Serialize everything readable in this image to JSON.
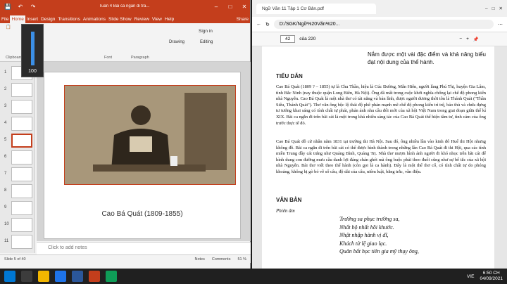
{
  "ppt": {
    "title": "Tuan 4 Bai ca ngan di tra...",
    "tabs": [
      "File",
      "Home",
      "Insert",
      "Design",
      "Transitions",
      "Animations",
      "Slide Show",
      "Review",
      "View",
      "Help",
      "Share"
    ],
    "active_tab": "Home",
    "sign_in": "Sign in",
    "ribbon_groups": [
      "Clipboard",
      "Font",
      "Paragraph"
    ],
    "ribbon_buttons": [
      "Drawing",
      "Editing"
    ],
    "slide_caption": "Cao Bá Quát (1809-1855)",
    "notes_placeholder": "Click to add notes",
    "status_slide": "Slide 5 of 40",
    "status_notes": "Notes",
    "status_comments": "Comments",
    "zoom": "51 %",
    "thumb_numbers": [
      "1",
      "2",
      "3",
      "4",
      "5",
      "6",
      "7",
      "8",
      "9",
      "10",
      "11"
    ],
    "selected_thumb": "5"
  },
  "volume": {
    "value": "100",
    "level": 1.0
  },
  "pdf": {
    "tab_title": "Ngữ Văn 11 Tập 1 Cơ Bản.pdf",
    "url": "D:/SGK/Ngữ%20Văn%20...",
    "page_current": "42",
    "page_total": "của 220",
    "top_text": "Nắm được một vài đặc điểm và khả năng biểu đạt nội dung của thể hành.",
    "heading_intro": "TIỂU DẪN",
    "para1": "Cao Bá Quát (1809 ? – 1855) tự là Chu Thần, hiệu là Cúc Đường, Mẫn Hiên, người làng Phú Thị, huyện Gia Lâm, tỉnh Bắc Ninh (nay thuộc quận Long Biên, Hà Nội). Ông đã mất trong cuộc khởi nghĩa chống lại chế độ phong kiến nhà Nguyễn. Cao Bá Quát là một nhà thơ có tài năng và bản lĩnh, được người đương thời tôn là Thánh Quát (\"Thần Siêu, Thánh Quát\"). Thơ văn ông bộc lộ thái độ phê phán mạnh mẽ chế độ phong kiến trì trệ, bảo thủ và chứa đựng tư tưởng khai sáng có tính chất tự phát, phản ánh nhu cầu đổi mới của xã hội Việt Nam trong giai đoạn giữa thế kỉ XIX. Bài ca ngắn đi trên bãi cát là một trong khá nhiều sáng tác của Cao Bá Quát thể hiện tâm tư, tình cảm của ông trước thực tế đó.",
    "para2": "Cao Bá Quát đỗ cử nhân năm 1831 tại trường thi Hà Nội. Sau đó, ông nhiều lần vào kinh đô Huế thi Hội nhưng không đỗ. Bài ca ngắn đi trên bãi cát có thể được hình thành trong những lần Cao Bá Quát đi thi Hội, qua các tỉnh miền Trung đầy cát trắng như Quảng Bình, Quảng Trị. Nhà thơ mượn hình ảnh người đi khó nhọc trên bãi cát để hình dung con đường mưu cầu danh lợi đáng chán ghét mà ông buộc phải theo đuổi cũng như sự bế tắc của xã hội nhà Nguyễn. Bài thơ viết theo thể hành (còn gọi là ca hành). Đây là một thể thơ cổ, có tính chất tự do phóng khoáng, không bị gò bó về số câu, độ dài của câu, niêm luật, bằng trắc, vần điệu.",
    "heading_text": "VĂN BẢN",
    "phien_am": "Phiên âm",
    "poem": [
      "Trường sa phục trường sa,",
      "Nhất bộ nhất hồi khước.",
      "Nhật nhập hành vị dĩ,",
      "Khách tử lệ giao lạc.",
      "Quân bất học tiên gia mỹ thụy ông,"
    ]
  },
  "taskbar": {
    "lang": "VIE",
    "time": "6:50 CH",
    "date": "04/09/2021"
  }
}
